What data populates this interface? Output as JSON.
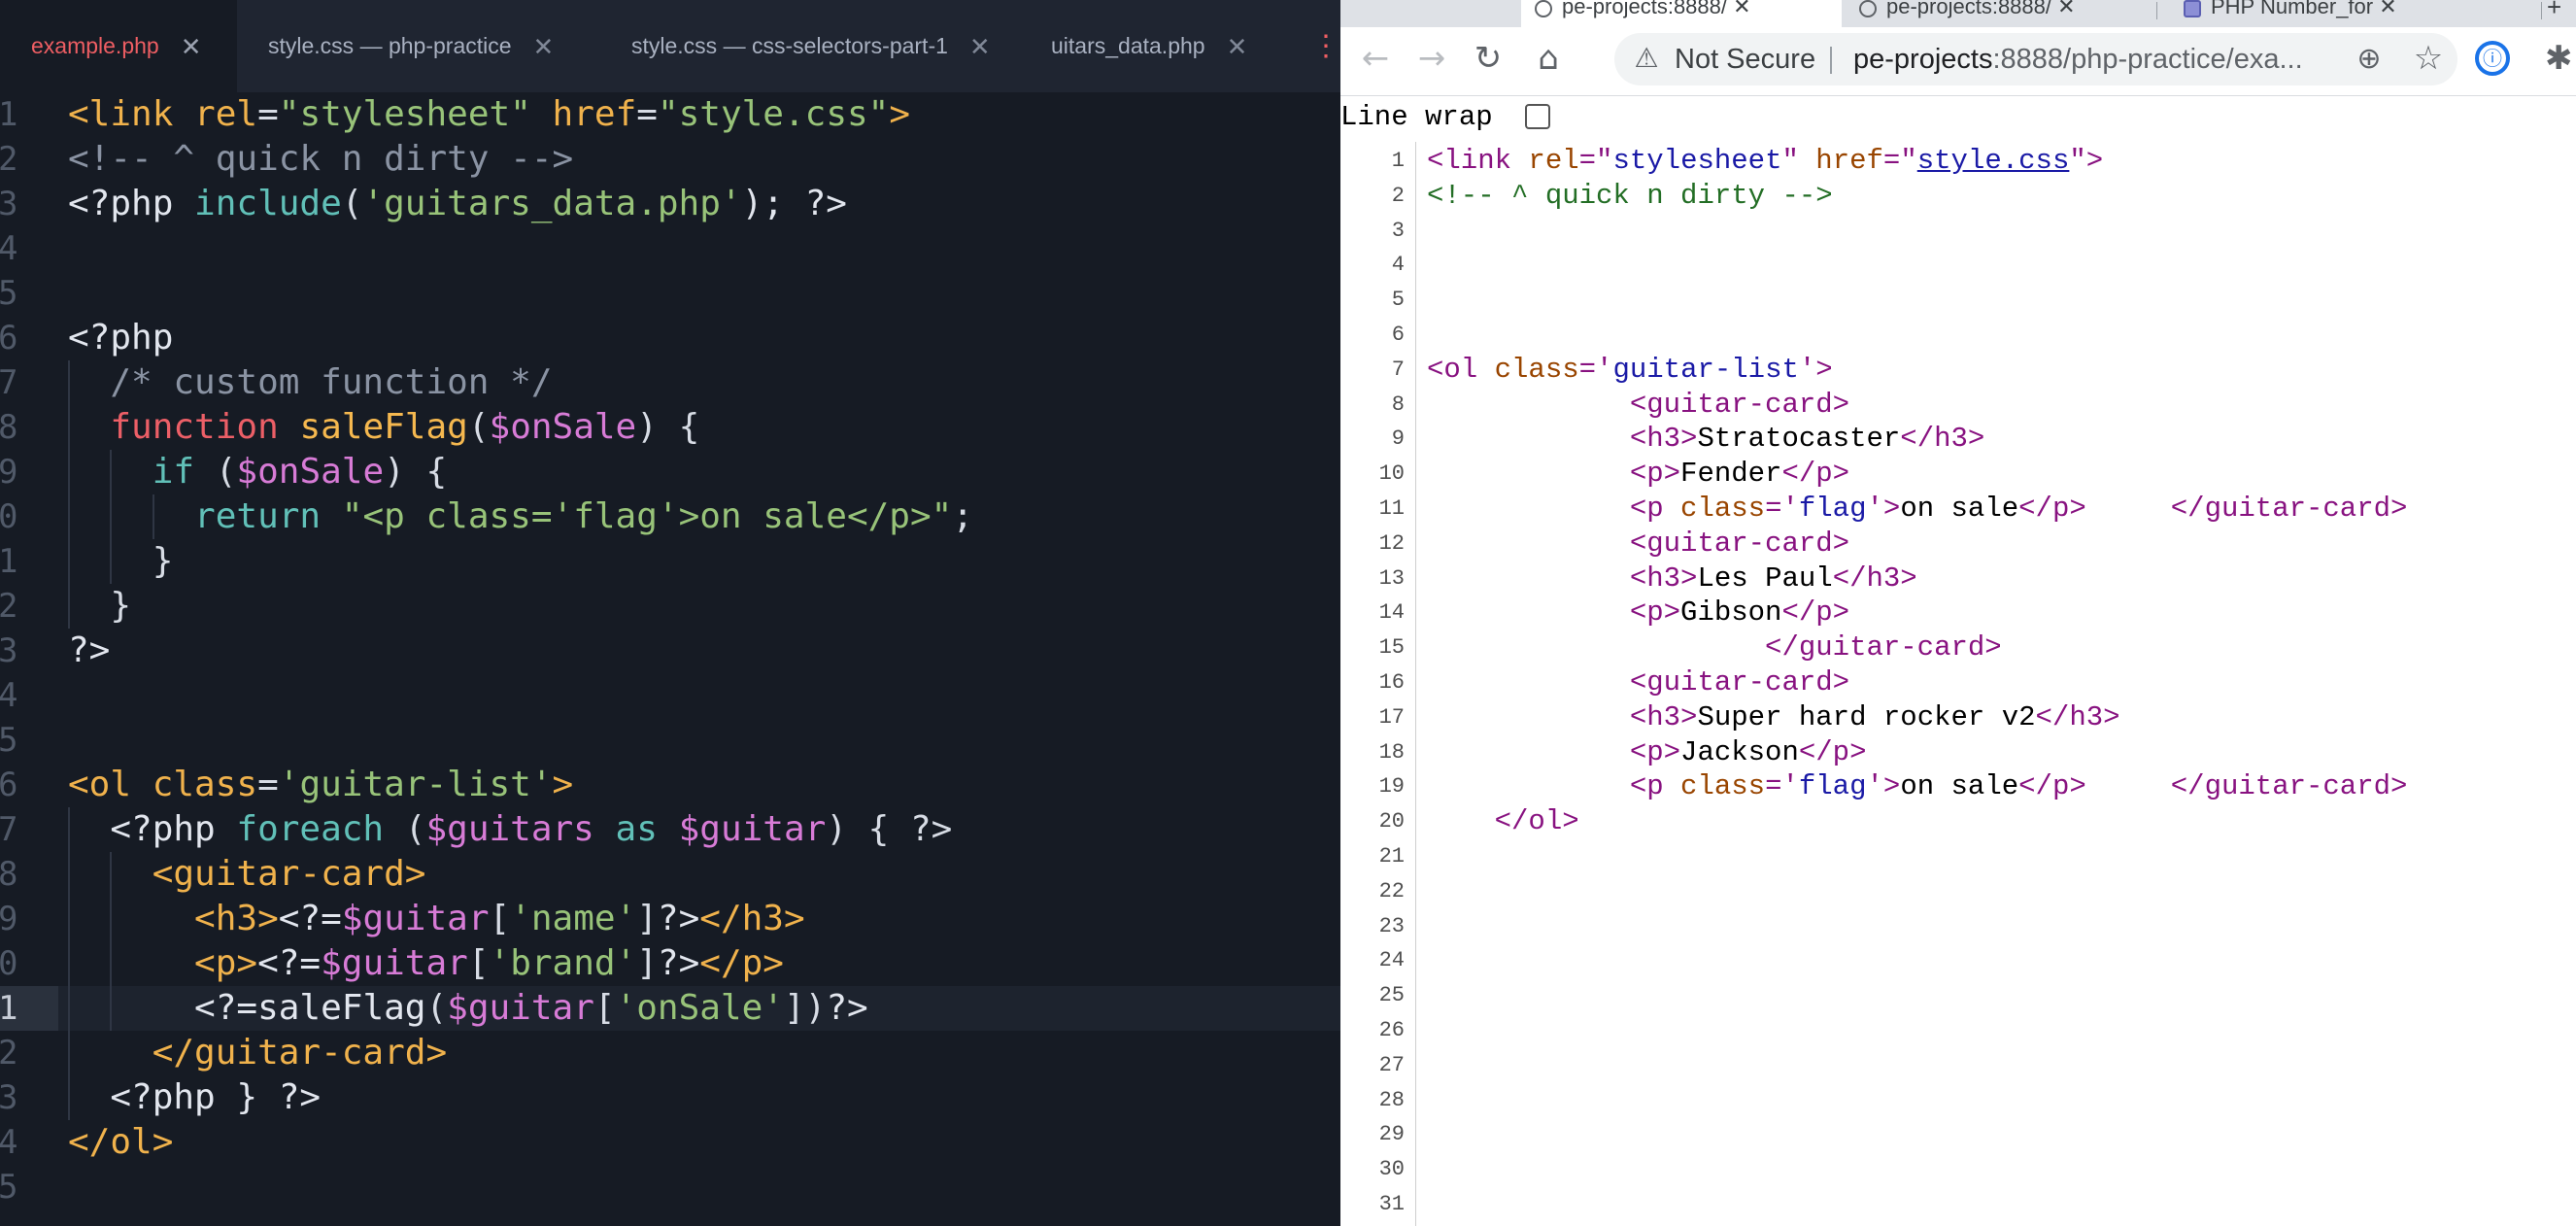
{
  "editor": {
    "tabs": [
      {
        "label": "example.php",
        "active": true
      },
      {
        "label": "style.css — php-practice",
        "active": false
      },
      {
        "label": "style.css — css-selectors-part-1",
        "active": false
      },
      {
        "label": "uitars_data.php",
        "active": false
      }
    ],
    "close_glyph": "✕",
    "more_glyph": "⋮",
    "current_line": 21,
    "lines": [
      {
        "n": "1",
        "tokens": [
          [
            "<link ",
            "t-tag"
          ],
          [
            "rel",
            "t-attr"
          ],
          [
            "=",
            "t-punc"
          ],
          [
            "\"stylesheet\"",
            "t-str"
          ],
          [
            " ",
            "t-punc"
          ],
          [
            "href",
            "t-attr"
          ],
          [
            "=",
            "t-punc"
          ],
          [
            "\"style.css\"",
            "t-str"
          ],
          [
            ">",
            "t-tag"
          ]
        ]
      },
      {
        "n": "2",
        "tokens": [
          [
            "<!-- ^ quick n dirty -->",
            "t-cmt"
          ]
        ]
      },
      {
        "n": "3",
        "tokens": [
          [
            "<?php ",
            "t-php"
          ],
          [
            "include",
            "t-bi"
          ],
          [
            "(",
            "t-punc"
          ],
          [
            "'guitars_data.php'",
            "t-str"
          ],
          [
            "); ?>",
            "t-php"
          ]
        ]
      },
      {
        "n": "4",
        "tokens": []
      },
      {
        "n": "5",
        "tokens": []
      },
      {
        "n": "6",
        "tokens": [
          [
            "<?php",
            "t-php"
          ]
        ]
      },
      {
        "n": "7",
        "tokens": [
          [
            "  /* custom function */",
            "t-cmt"
          ]
        ]
      },
      {
        "n": "8",
        "tokens": [
          [
            "  ",
            "t-punc"
          ],
          [
            "function",
            "t-kw"
          ],
          [
            " ",
            "t-punc"
          ],
          [
            "saleFlag",
            "t-fn"
          ],
          [
            "(",
            "t-punc"
          ],
          [
            "$onSale",
            "t-var"
          ],
          [
            ") {",
            "t-punc"
          ]
        ]
      },
      {
        "n": "9",
        "tokens": [
          [
            "    ",
            "t-punc"
          ],
          [
            "if",
            "t-bi"
          ],
          [
            " (",
            "t-punc"
          ],
          [
            "$onSale",
            "t-var"
          ],
          [
            ") {",
            "t-punc"
          ]
        ]
      },
      {
        "n": "0",
        "tokens": [
          [
            "      ",
            "t-punc"
          ],
          [
            "return",
            "t-bi"
          ],
          [
            " ",
            "t-punc"
          ],
          [
            "\"<p class='flag'>on sale</p>\"",
            "t-str"
          ],
          [
            ";",
            "t-punc"
          ]
        ]
      },
      {
        "n": "1",
        "tokens": [
          [
            "    }",
            "t-punc"
          ]
        ]
      },
      {
        "n": "2",
        "tokens": [
          [
            "  }",
            "t-punc"
          ]
        ]
      },
      {
        "n": "3",
        "tokens": [
          [
            "?>",
            "t-php"
          ]
        ]
      },
      {
        "n": "4",
        "tokens": []
      },
      {
        "n": "5",
        "tokens": []
      },
      {
        "n": "6",
        "tokens": [
          [
            "<ol ",
            "t-tag"
          ],
          [
            "class",
            "t-attr"
          ],
          [
            "=",
            "t-punc"
          ],
          [
            "'guitar-list'",
            "t-str"
          ],
          [
            ">",
            "t-tag"
          ]
        ]
      },
      {
        "n": "7",
        "tokens": [
          [
            "  <?php ",
            "t-php"
          ],
          [
            "foreach",
            "t-bi"
          ],
          [
            " (",
            "t-punc"
          ],
          [
            "$guitars",
            "t-var"
          ],
          [
            " ",
            "t-punc"
          ],
          [
            "as",
            "t-bi"
          ],
          [
            " ",
            "t-punc"
          ],
          [
            "$guitar",
            "t-var"
          ],
          [
            ") { ?>",
            "t-punc"
          ]
        ]
      },
      {
        "n": "8",
        "tokens": [
          [
            "    <guitar-card>",
            "t-tag"
          ]
        ]
      },
      {
        "n": "9",
        "tokens": [
          [
            "      <h3>",
            "t-tag"
          ],
          [
            "<?=",
            "t-php"
          ],
          [
            "$guitar",
            "t-var"
          ],
          [
            "[",
            "t-punc"
          ],
          [
            "'name'",
            "t-str"
          ],
          [
            "]",
            "t-punc"
          ],
          [
            "?>",
            "t-php"
          ],
          [
            "</h3>",
            "t-tag"
          ]
        ]
      },
      {
        "n": "0",
        "tokens": [
          [
            "      <p>",
            "t-tag"
          ],
          [
            "<?=",
            "t-php"
          ],
          [
            "$guitar",
            "t-var"
          ],
          [
            "[",
            "t-punc"
          ],
          [
            "'brand'",
            "t-str"
          ],
          [
            "]",
            "t-punc"
          ],
          [
            "?>",
            "t-php"
          ],
          [
            "</p>",
            "t-tag"
          ]
        ]
      },
      {
        "n": "1",
        "tokens": [
          [
            "      ",
            "t-punc"
          ],
          [
            "<?=",
            "t-php"
          ],
          [
            "saleFlag",
            "t-php"
          ],
          [
            "(",
            "t-punc"
          ],
          [
            "$guitar",
            "t-var"
          ],
          [
            "[",
            "t-punc"
          ],
          [
            "'onSale'",
            "t-str"
          ],
          [
            "])",
            "t-punc"
          ],
          [
            "?>",
            "t-php"
          ]
        ]
      },
      {
        "n": "2",
        "tokens": [
          [
            "    </guitar-card>",
            "t-tag"
          ]
        ]
      },
      {
        "n": "3",
        "tokens": [
          [
            "  <?php } ?>",
            "t-php"
          ]
        ]
      },
      {
        "n": "4",
        "tokens": [
          [
            "</ol>",
            "t-tag"
          ]
        ]
      },
      {
        "n": "5",
        "tokens": []
      }
    ]
  },
  "browser": {
    "tabs": [
      {
        "label": "pe-projects:8888/ ✕",
        "active": true
      },
      {
        "label": "pe-projects:8888/ ✕",
        "active": false
      },
      {
        "label": "PHP Number_for ✕",
        "active": false
      }
    ],
    "new_tab_glyph": "+",
    "back_glyph": "←",
    "forward_glyph": "→",
    "reload_glyph": "↻",
    "home_glyph": "⌂",
    "warning_glyph": "⚠",
    "not_secure": "Not Secure",
    "url_host": "pe-projects",
    "url_path": ":8888/php-practice/exa...",
    "zoom_glyph": "⊕",
    "star_glyph": "☆",
    "ext1_glyph": "ⓘ",
    "ext2_glyph": "✱",
    "line_wrap_label": "Line wrap",
    "source_lines": [
      {
        "n": "1",
        "tokens": [
          [
            "<link ",
            "s-tag"
          ],
          [
            "rel",
            "s-attr"
          ],
          [
            "=\"",
            "s-tag"
          ],
          [
            "stylesheet",
            "s-val"
          ],
          [
            "\" ",
            "s-tag"
          ],
          [
            "href",
            "s-attr"
          ],
          [
            "=\"",
            "s-tag"
          ],
          [
            "style.css",
            "s-link"
          ],
          [
            "\">",
            "s-tag"
          ]
        ]
      },
      {
        "n": "2",
        "tokens": [
          [
            "<!-- ^ quick n dirty -->",
            "s-cmt"
          ]
        ]
      },
      {
        "n": "3",
        "tokens": []
      },
      {
        "n": "4",
        "tokens": []
      },
      {
        "n": "5",
        "tokens": []
      },
      {
        "n": "6",
        "tokens": []
      },
      {
        "n": "7",
        "tokens": [
          [
            "<ol ",
            "s-tag"
          ],
          [
            "class",
            "s-attr"
          ],
          [
            "='",
            "s-tag"
          ],
          [
            "guitar-list",
            "s-val"
          ],
          [
            "'>",
            "s-tag"
          ]
        ]
      },
      {
        "n": "8",
        "tokens": [
          [
            "            <guitar-card>",
            "s-tag"
          ]
        ]
      },
      {
        "n": "9",
        "tokens": [
          [
            "            <h3>",
            "s-tag"
          ],
          [
            "Stratocaster",
            "s-txt"
          ],
          [
            "</h3>",
            "s-tag"
          ]
        ]
      },
      {
        "n": "10",
        "tokens": [
          [
            "            <p>",
            "s-tag"
          ],
          [
            "Fender",
            "s-txt"
          ],
          [
            "</p>",
            "s-tag"
          ]
        ]
      },
      {
        "n": "11",
        "tokens": [
          [
            "            <p ",
            "s-tag"
          ],
          [
            "class",
            "s-attr"
          ],
          [
            "='",
            "s-tag"
          ],
          [
            "flag",
            "s-val"
          ],
          [
            "'>",
            "s-tag"
          ],
          [
            "on sale",
            "s-txt"
          ],
          [
            "</p>",
            "s-tag"
          ],
          [
            "     </guitar-card>",
            "s-tag"
          ]
        ]
      },
      {
        "n": "12",
        "tokens": [
          [
            "            <guitar-card>",
            "s-tag"
          ]
        ]
      },
      {
        "n": "13",
        "tokens": [
          [
            "            <h3>",
            "s-tag"
          ],
          [
            "Les Paul",
            "s-txt"
          ],
          [
            "</h3>",
            "s-tag"
          ]
        ]
      },
      {
        "n": "14",
        "tokens": [
          [
            "            <p>",
            "s-tag"
          ],
          [
            "Gibson",
            "s-txt"
          ],
          [
            "</p>",
            "s-tag"
          ]
        ]
      },
      {
        "n": "15",
        "tokens": [
          [
            "                    </guitar-card>",
            "s-tag"
          ]
        ]
      },
      {
        "n": "16",
        "tokens": [
          [
            "            <guitar-card>",
            "s-tag"
          ]
        ]
      },
      {
        "n": "17",
        "tokens": [
          [
            "            <h3>",
            "s-tag"
          ],
          [
            "Super hard rocker v2",
            "s-txt"
          ],
          [
            "</h3>",
            "s-tag"
          ]
        ]
      },
      {
        "n": "18",
        "tokens": [
          [
            "            <p>",
            "s-tag"
          ],
          [
            "Jackson",
            "s-txt"
          ],
          [
            "</p>",
            "s-tag"
          ]
        ]
      },
      {
        "n": "19",
        "tokens": [
          [
            "            <p ",
            "s-tag"
          ],
          [
            "class",
            "s-attr"
          ],
          [
            "='",
            "s-tag"
          ],
          [
            "flag",
            "s-val"
          ],
          [
            "'>",
            "s-tag"
          ],
          [
            "on sale",
            "s-txt"
          ],
          [
            "</p>",
            "s-tag"
          ],
          [
            "     </guitar-card>",
            "s-tag"
          ]
        ]
      },
      {
        "n": "20",
        "tokens": [
          [
            "    </ol>",
            "s-tag"
          ]
        ]
      },
      {
        "n": "21",
        "tokens": []
      },
      {
        "n": "22",
        "tokens": []
      },
      {
        "n": "23",
        "tokens": []
      },
      {
        "n": "24",
        "tokens": []
      },
      {
        "n": "25",
        "tokens": []
      },
      {
        "n": "26",
        "tokens": []
      },
      {
        "n": "27",
        "tokens": []
      },
      {
        "n": "28",
        "tokens": []
      },
      {
        "n": "29",
        "tokens": []
      },
      {
        "n": "30",
        "tokens": []
      },
      {
        "n": "31",
        "tokens": []
      }
    ]
  }
}
